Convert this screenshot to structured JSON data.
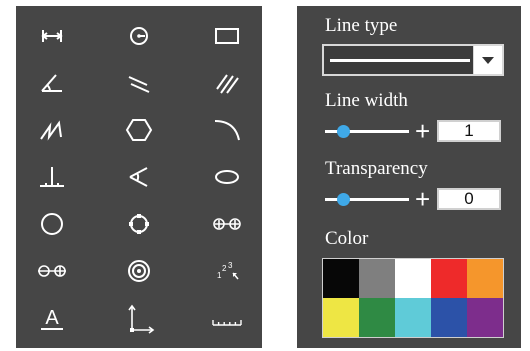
{
  "tools_panel": {
    "tools": [
      {
        "icon": "horizontal-dimension-icon"
      },
      {
        "icon": "circle-center-point-icon"
      },
      {
        "icon": "rectangle-icon"
      },
      {
        "icon": "angle-icon"
      },
      {
        "icon": "parallel-lines-icon"
      },
      {
        "icon": "hatch-lines-icon"
      },
      {
        "icon": "polyline-icon"
      },
      {
        "icon": "hexagon-icon"
      },
      {
        "icon": "arc-icon"
      },
      {
        "icon": "perpendicular-icon"
      },
      {
        "icon": "angle-two-point-icon"
      },
      {
        "icon": "ellipse-icon"
      },
      {
        "icon": "circle-icon"
      },
      {
        "icon": "circle-by-points-icon"
      },
      {
        "icon": "circle-to-circle-distance-icon"
      },
      {
        "icon": "circles-distance-icon"
      },
      {
        "icon": "concentric-circles-icon"
      },
      {
        "icon": "point-numbering-icon"
      },
      {
        "icon": "text-annotation-icon"
      },
      {
        "icon": "coordinate-axes-icon"
      },
      {
        "icon": "scale-bar-icon"
      }
    ],
    "text_tool_glyph": "A",
    "numbering_glyph": "1 2 3"
  },
  "properties_panel": {
    "line_type": {
      "label": "Line type",
      "selected": "solid-line",
      "dropdown_icon": "caret-down-icon"
    },
    "line_width": {
      "label": "Line width",
      "value": "1",
      "plus": "+",
      "slider_fraction": 0.22
    },
    "transparency": {
      "label": "Transparency",
      "value": "0",
      "plus": "+",
      "slider_fraction": 0.22
    },
    "color": {
      "label": "Color",
      "swatches": [
        "#070707",
        "#7f7f7f",
        "#ffffff",
        "#ee2a2a",
        "#f5962c",
        "#eee644",
        "#2f8a44",
        "#5fcbd8",
        "#2c52a8",
        "#7d2d8c"
      ]
    }
  }
}
